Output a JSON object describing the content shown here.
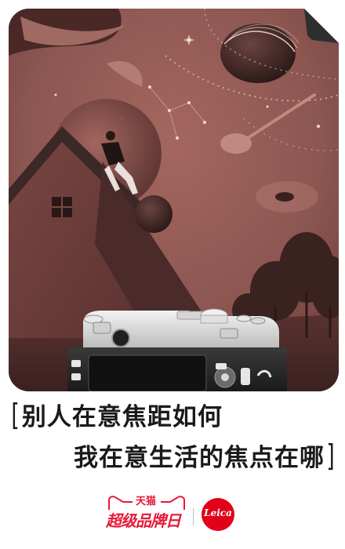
{
  "poster": {
    "headline": {
      "open_bracket": "[",
      "line1": "别人在意焦距如何",
      "line2": "我在意生活的焦点在哪",
      "close_bracket": "]"
    },
    "brands": {
      "tmall_small": "天猫",
      "tmall_big": "超级品牌日",
      "leica": "Leica"
    },
    "colors": {
      "sky": "#8c5651",
      "house": "#6d3d3a",
      "roof": "#3c2826",
      "camera_body": "#2b2b2b",
      "camera_top": "#e6e6e6",
      "tmall_red": "#e8183a",
      "leica_red": "#e2001a"
    }
  }
}
